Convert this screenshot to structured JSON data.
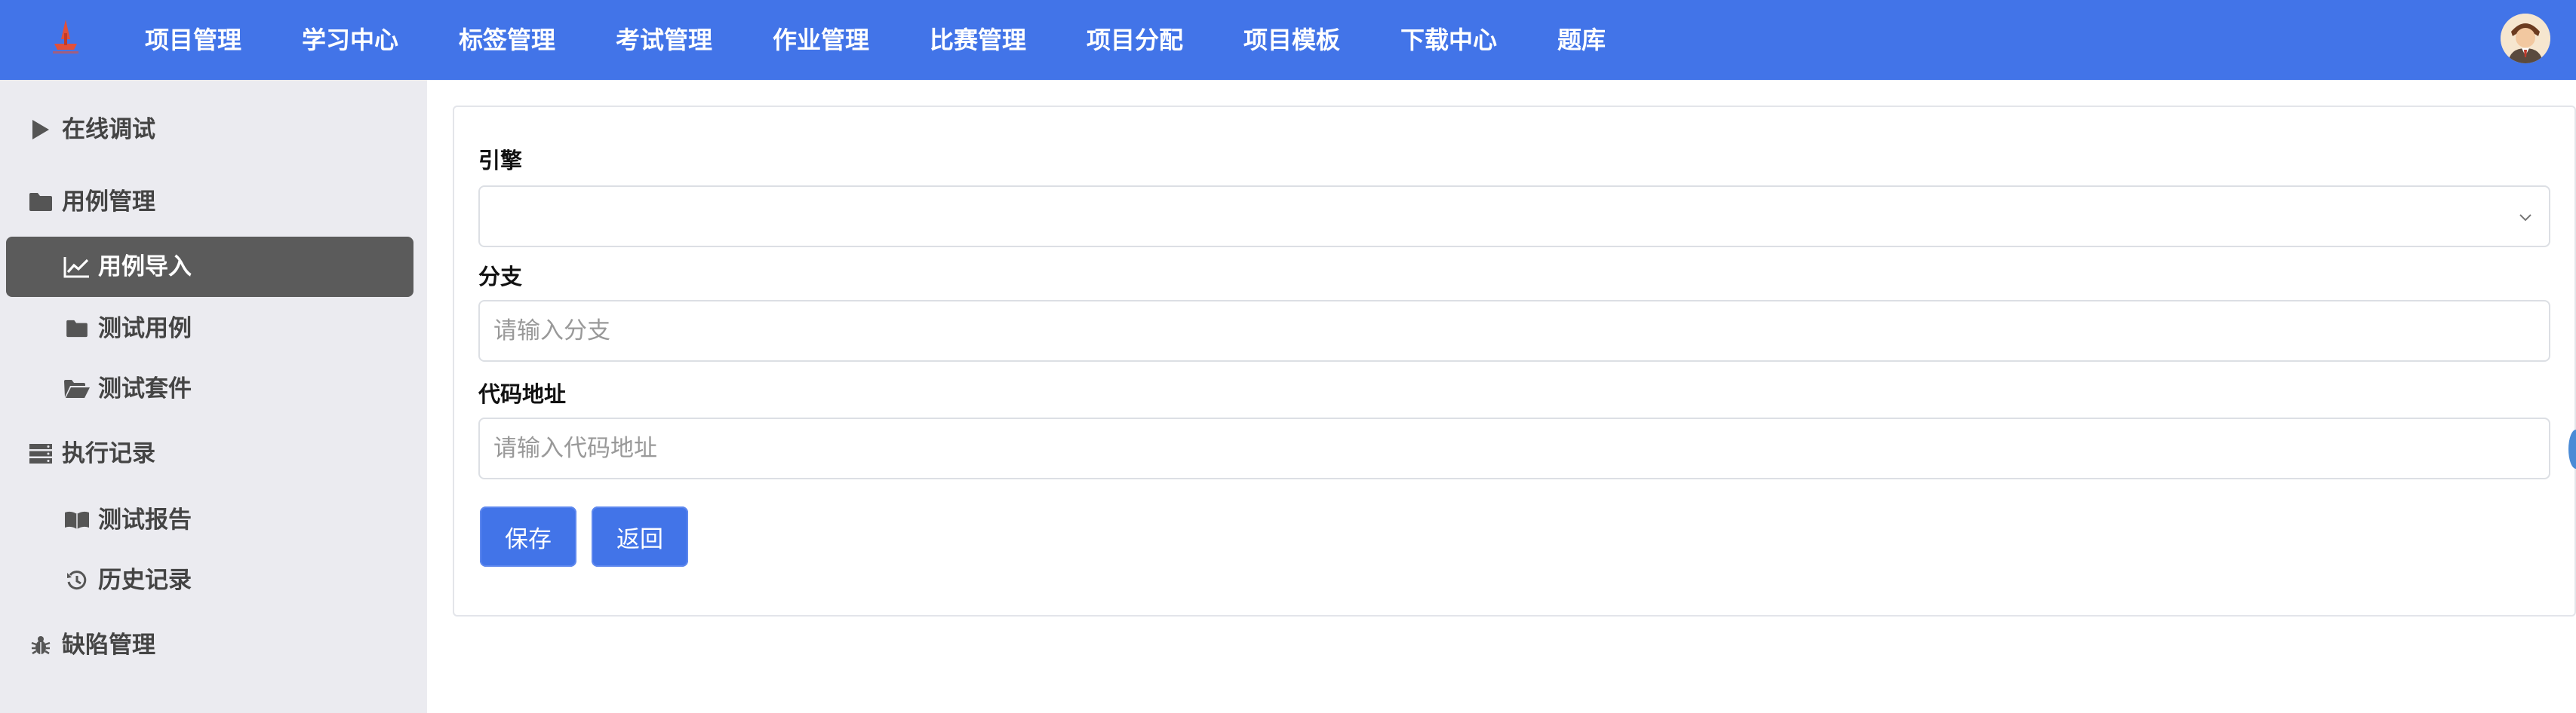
{
  "nav": {
    "items": [
      "项目管理",
      "学习中心",
      "标签管理",
      "考试管理",
      "作业管理",
      "比赛管理",
      "项目分配",
      "项目模板",
      "下载中心",
      "题库"
    ]
  },
  "sidebar": {
    "online_debug": "在线调试",
    "case_management": "用例管理",
    "case_import": "用例导入",
    "test_cases": "测试用例",
    "test_suites": "测试套件",
    "execution_records": "执行记录",
    "test_reports": "测试报告",
    "history_records": "历史记录",
    "defect_management": "缺陷管理"
  },
  "form": {
    "engine_label": "引擎",
    "engine_value": "",
    "branch_label": "分支",
    "branch_placeholder": "请输入分支",
    "repo_label": "代码地址",
    "repo_placeholder": "请输入代码地址",
    "save_label": "保存",
    "back_label": "返回"
  },
  "colors": {
    "primary": "#4274e8",
    "sidebar_bg": "#ebebf0",
    "active_item_bg": "#5b5b5b"
  }
}
